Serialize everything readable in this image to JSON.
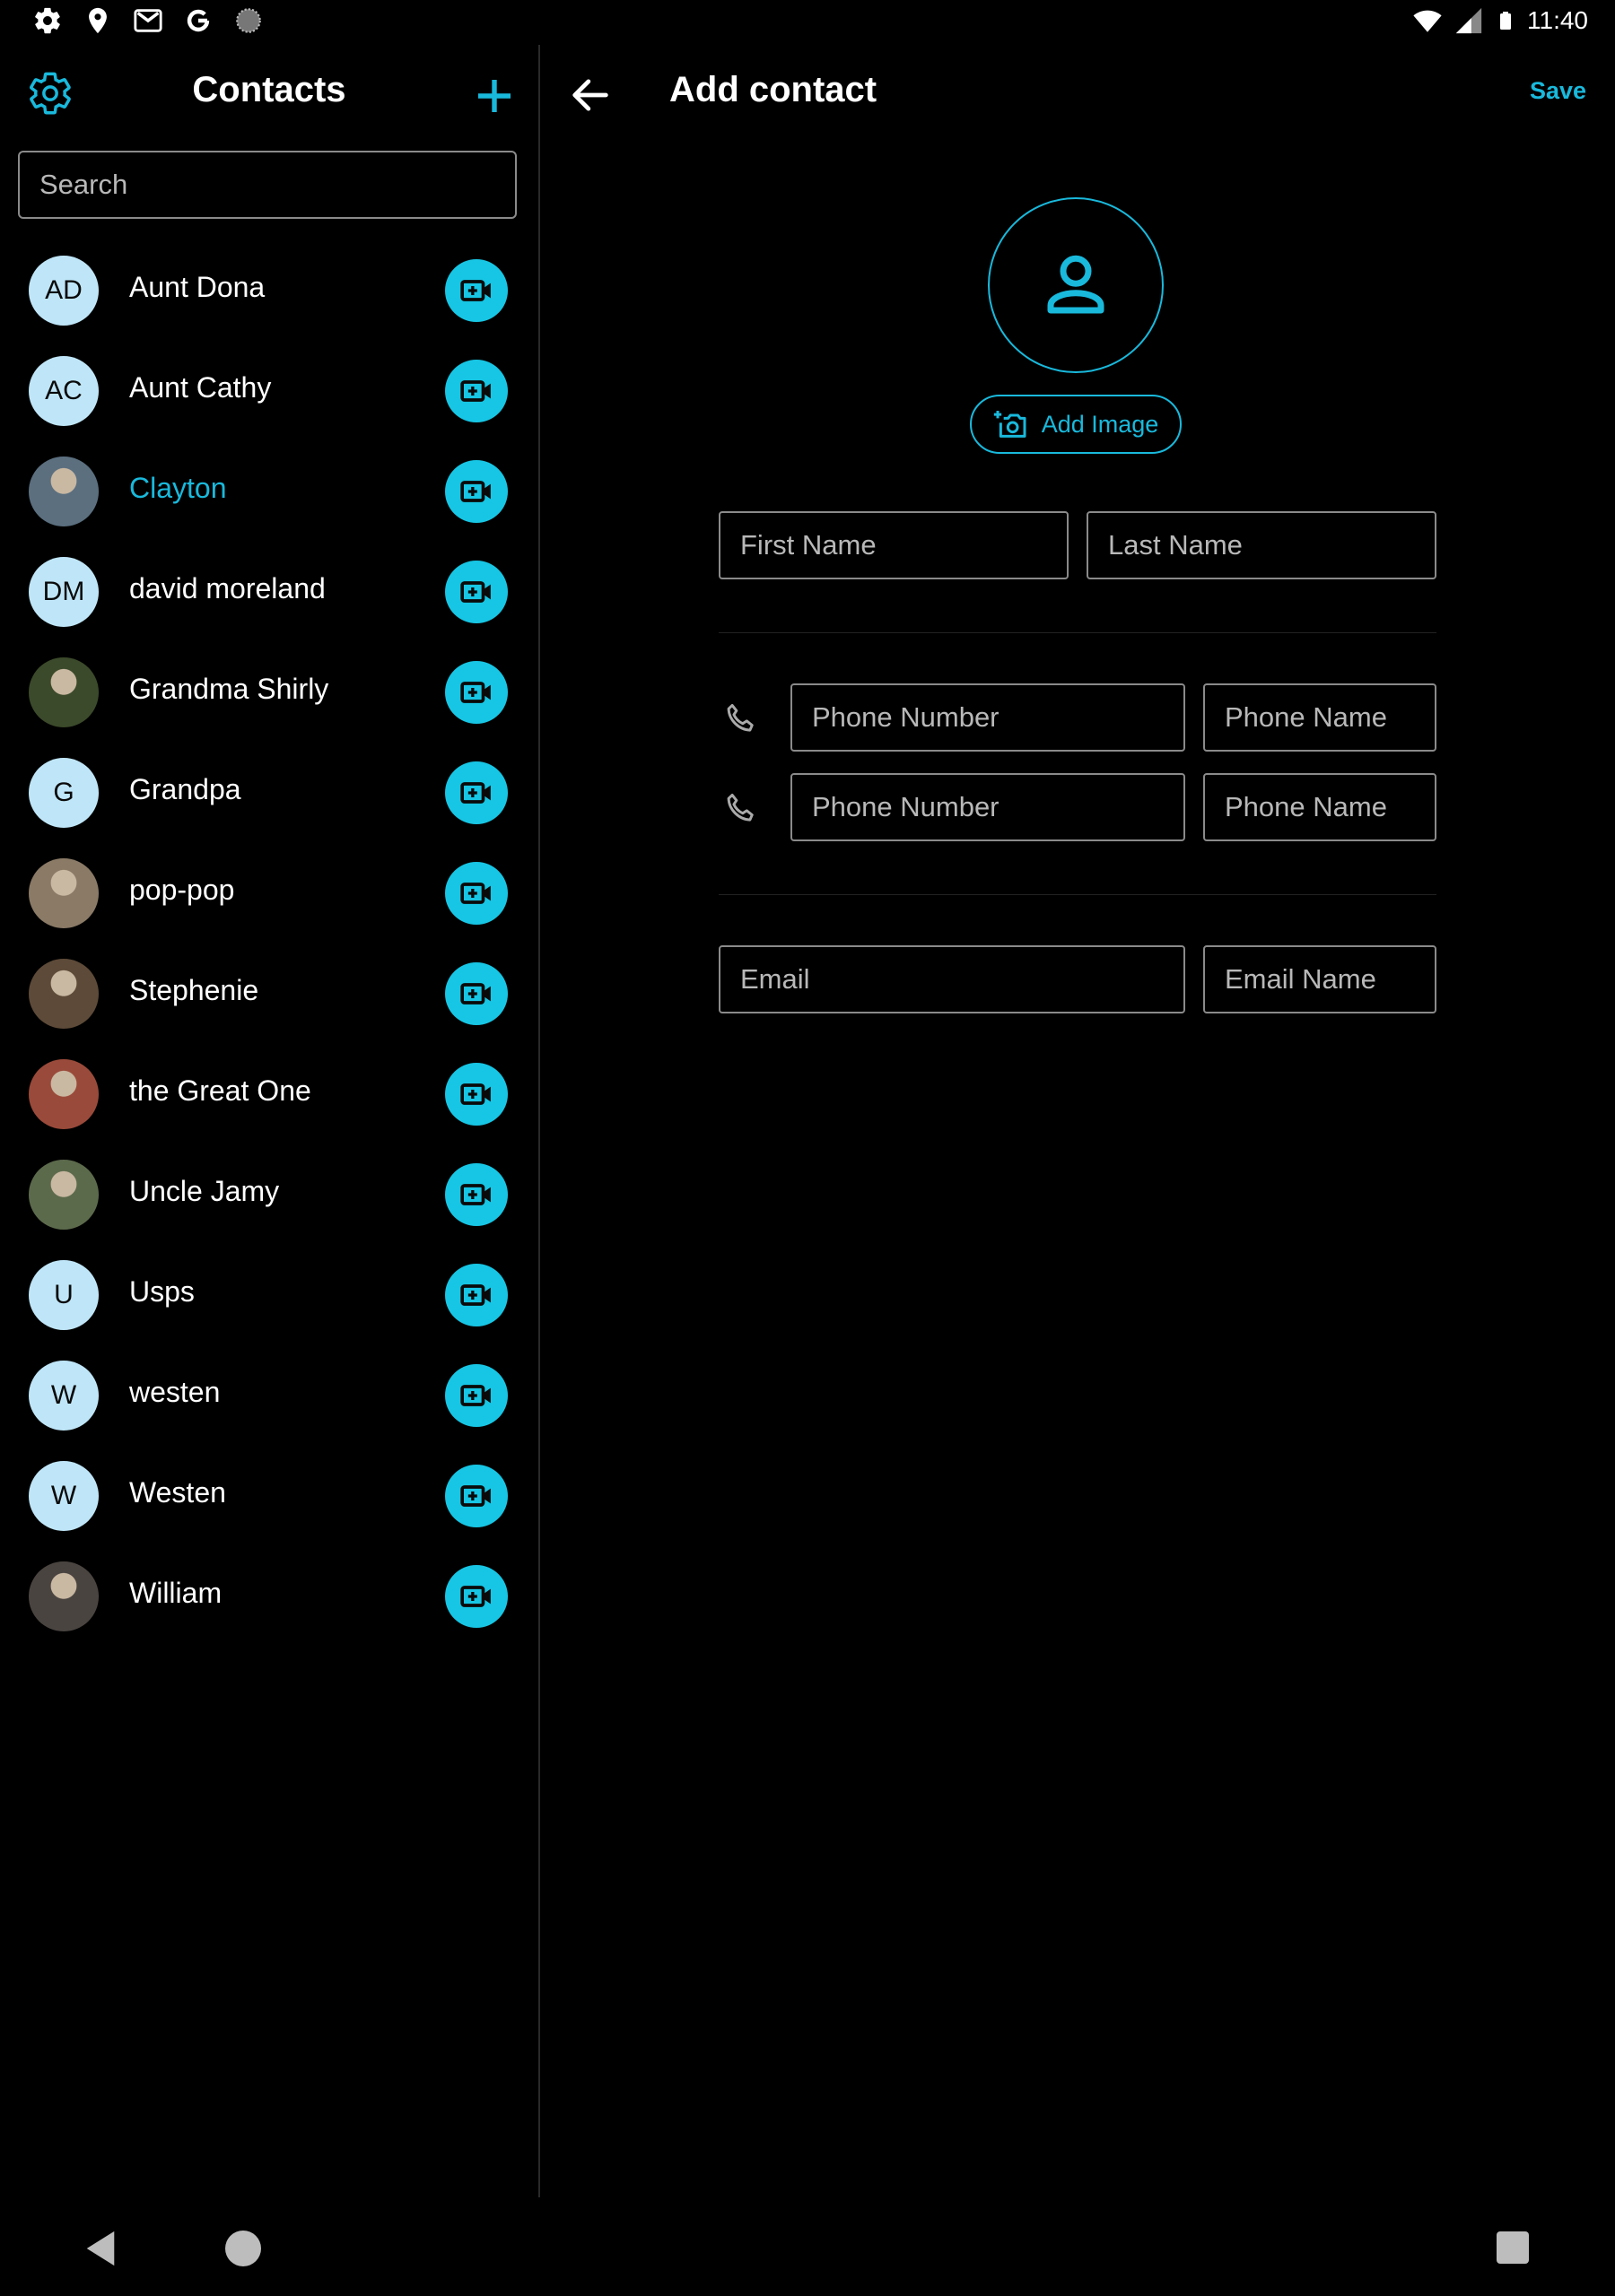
{
  "status_bar": {
    "time": "11:40",
    "left_icons": [
      "gear-icon",
      "location-pin-icon",
      "gmail-icon",
      "google-icon",
      "moon-icon"
    ],
    "right_icons": [
      "wifi-icon",
      "cell-signal-icon",
      "battery-icon"
    ]
  },
  "contacts_panel": {
    "title": "Contacts",
    "search_placeholder": "Search",
    "contacts": [
      {
        "name": "Aunt Dona",
        "initials": "AD",
        "avatar_type": "initials",
        "selected": false
      },
      {
        "name": "Aunt Cathy",
        "initials": "AC",
        "avatar_type": "initials",
        "selected": false
      },
      {
        "name": "Clayton",
        "initials": "",
        "avatar_type": "photo",
        "selected": true
      },
      {
        "name": "david moreland",
        "initials": "DM",
        "avatar_type": "initials",
        "selected": false
      },
      {
        "name": "Grandma Shirly",
        "initials": "",
        "avatar_type": "photo",
        "selected": false
      },
      {
        "name": "Grandpa",
        "initials": "G",
        "avatar_type": "initials",
        "selected": false
      },
      {
        "name": "pop-pop",
        "initials": "",
        "avatar_type": "photo",
        "selected": false
      },
      {
        "name": "Stephenie",
        "initials": "",
        "avatar_type": "photo",
        "selected": false
      },
      {
        "name": "the Great One",
        "initials": "",
        "avatar_type": "photo",
        "selected": false
      },
      {
        "name": "Uncle Jamy",
        "initials": "",
        "avatar_type": "photo",
        "selected": false
      },
      {
        "name": "Usps",
        "initials": "U",
        "avatar_type": "initials",
        "selected": false
      },
      {
        "name": "westen",
        "initials": "W",
        "avatar_type": "initials",
        "selected": false
      },
      {
        "name": "Westen",
        "initials": "W",
        "avatar_type": "initials",
        "selected": false
      },
      {
        "name": "William",
        "initials": "",
        "avatar_type": "photo",
        "selected": false
      }
    ]
  },
  "add_contact_panel": {
    "title": "Add contact",
    "save_label": "Save",
    "add_image_label": "Add Image",
    "first_name_placeholder": "First Name",
    "last_name_placeholder": "Last Name",
    "phones": [
      {
        "number_placeholder": "Phone Number",
        "name_placeholder": "Phone Name"
      },
      {
        "number_placeholder": "Phone Number",
        "name_placeholder": "Phone Name"
      }
    ],
    "email_placeholder": "Email",
    "email_name_placeholder": "Email Name"
  },
  "colors": {
    "accent": "#19b9dc",
    "call_button": "#17c6e4",
    "initials_avatar": "#bfe6f8",
    "background": "#000000"
  }
}
